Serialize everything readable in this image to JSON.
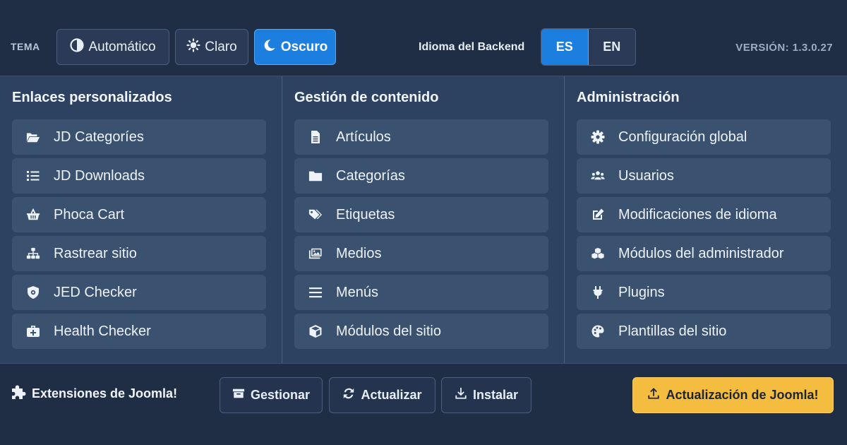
{
  "theme": {
    "label": "TEMA",
    "options": [
      {
        "label": "Automático",
        "icon": "half-circle-icon"
      },
      {
        "label": "Claro",
        "icon": "sun-icon"
      },
      {
        "label": "Oscuro",
        "icon": "moon-icon",
        "active": true
      }
    ]
  },
  "language": {
    "label": "Idioma del Backend",
    "options": [
      {
        "label": "ES",
        "active": true
      },
      {
        "label": "EN"
      }
    ]
  },
  "version": "VERSIÓN: 1.3.0.27",
  "columns": [
    {
      "title": "Enlaces personalizados",
      "items": [
        {
          "label": "JD Categoríes",
          "icon": "folder-open-icon"
        },
        {
          "label": "JD Downloads",
          "icon": "list-icon"
        },
        {
          "label": "Phoca Cart",
          "icon": "basket-icon"
        },
        {
          "label": "Rastrear sitio",
          "icon": "sitemap-icon"
        },
        {
          "label": "JED Checker",
          "icon": "shield-icon"
        },
        {
          "label": "Health Checker",
          "icon": "medkit-icon"
        }
      ]
    },
    {
      "title": "Gestión de contenido",
      "items": [
        {
          "label": "Artículos",
          "icon": "file-icon"
        },
        {
          "label": "Categorías",
          "icon": "folder-icon"
        },
        {
          "label": "Etiquetas",
          "icon": "tags-icon"
        },
        {
          "label": "Medios",
          "icon": "images-icon"
        },
        {
          "label": "Menús",
          "icon": "bars-icon"
        },
        {
          "label": "Módulos del sitio",
          "icon": "cube-icon"
        }
      ]
    },
    {
      "title": "Administración",
      "items": [
        {
          "label": "Configuración global",
          "icon": "cog-icon"
        },
        {
          "label": "Usuarios",
          "icon": "users-icon"
        },
        {
          "label": "Modificaciones de idioma",
          "icon": "edit-icon"
        },
        {
          "label": "Módulos del administrador",
          "icon": "cubes-icon"
        },
        {
          "label": "Plugins",
          "icon": "plug-icon"
        },
        {
          "label": "Plantillas del sitio",
          "icon": "palette-icon"
        }
      ]
    }
  ],
  "extensions": {
    "title": "Extensiones de Joomla!",
    "buttons": {
      "manage": "Gestionar",
      "update": "Actualizar",
      "install": "Instalar",
      "joomla_update": "Actualización de Joomla!"
    }
  },
  "colors": {
    "background": "#1f2d45",
    "panel": "#2d4260",
    "accent": "#1c7fe0",
    "warning": "#f5bd3f"
  }
}
